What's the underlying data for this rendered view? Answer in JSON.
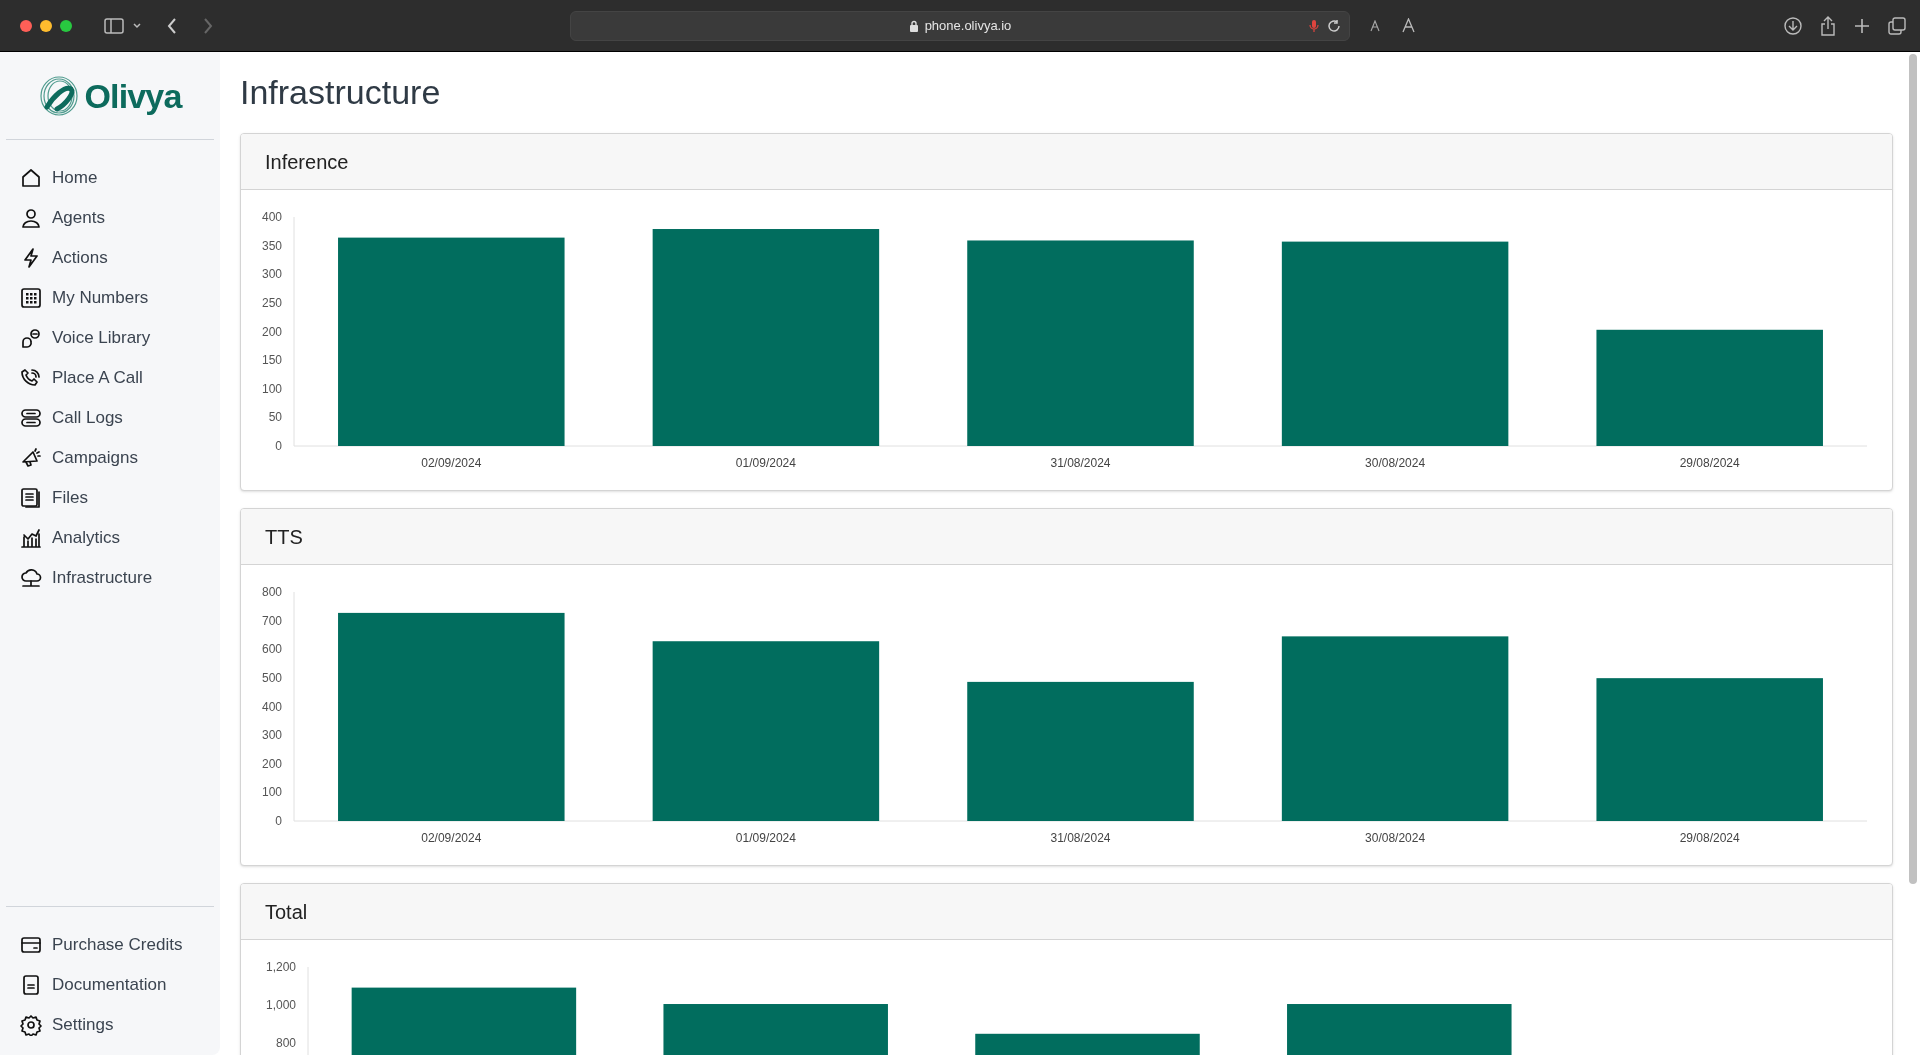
{
  "browser": {
    "url": "phone.olivya.io"
  },
  "sidebar": {
    "logo": "Olivya",
    "items": [
      {
        "label": "Home"
      },
      {
        "label": "Agents"
      },
      {
        "label": "Actions"
      },
      {
        "label": "My Numbers"
      },
      {
        "label": "Voice Library"
      },
      {
        "label": "Place A Call"
      },
      {
        "label": "Call Logs"
      },
      {
        "label": "Campaigns"
      },
      {
        "label": "Files"
      },
      {
        "label": "Analytics"
      },
      {
        "label": "Infrastructure"
      }
    ],
    "bottom_items": [
      {
        "label": "Purchase Credits"
      },
      {
        "label": "Documentation"
      },
      {
        "label": "Settings"
      }
    ]
  },
  "page": {
    "title": "Infrastructure"
  },
  "panels": [
    {
      "title": "Inference",
      "chart_data": {
        "type": "bar",
        "categories": [
          "02/09/2024",
          "01/09/2024",
          "31/08/2024",
          "30/08/2024",
          "29/08/2024"
        ],
        "series": [
          {
            "color": "#016d5e",
            "values": [
              364,
              379,
              359,
              357,
              203
            ]
          }
        ],
        "ylim": [
          0,
          400
        ],
        "yticks": [
          0,
          50,
          100,
          150,
          200,
          250,
          300,
          350,
          400
        ]
      }
    },
    {
      "title": "TTS",
      "chart_data": {
        "type": "bar",
        "categories": [
          "02/09/2024",
          "01/09/2024",
          "31/08/2024",
          "30/08/2024",
          "29/08/2024"
        ],
        "series": [
          {
            "color": "#016d5e",
            "values": [
              727,
              628,
              486,
              645,
              499
            ]
          }
        ],
        "ylim": [
          0,
          800
        ],
        "yticks": [
          0,
          100,
          200,
          300,
          400,
          500,
          600,
          700,
          800
        ]
      }
    },
    {
      "title": "Total",
      "chart_data": {
        "type": "bar",
        "series": [
          {
            "color": "#016d5e",
            "values": [
              1092,
              1006,
              850,
              1006,
              null
            ]
          }
        ],
        "ylim": [
          0,
          1200
        ],
        "yticks": [
          {
            "value": 800,
            "label": "800"
          },
          {
            "value": 1000,
            "label": "1,000"
          },
          {
            "value": 1200,
            "label": "1,200"
          }
        ]
      }
    }
  ]
}
